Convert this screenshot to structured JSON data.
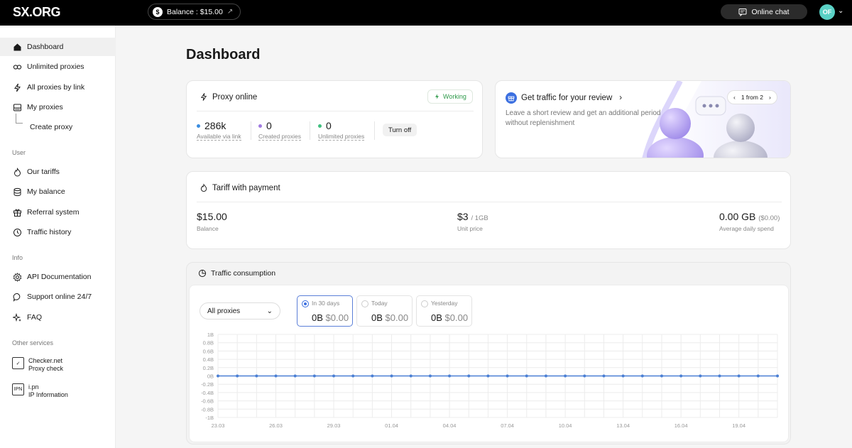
{
  "header": {
    "logo": "SX.ORG",
    "balance_label": "Balance : $15.00",
    "chat_label": "Online chat",
    "avatar_initials": "OF"
  },
  "sidebar": {
    "main_items": [
      {
        "label": "Dashboard",
        "icon": "home-icon"
      },
      {
        "label": "Unlimited proxies",
        "icon": "infinity-icon"
      },
      {
        "label": "All proxies by link",
        "icon": "bolt-icon"
      },
      {
        "label": "My proxies",
        "icon": "server-icon"
      },
      {
        "label": "Create proxy",
        "icon": ""
      }
    ],
    "user_section": "User",
    "user_items": [
      {
        "label": "Our tariffs",
        "icon": "flame-icon"
      },
      {
        "label": "My balance",
        "icon": "database-icon"
      },
      {
        "label": "Referral system",
        "icon": "gift-icon"
      },
      {
        "label": "Traffic history",
        "icon": "clock-icon"
      }
    ],
    "info_section": "Info",
    "info_items": [
      {
        "label": "API Documentation",
        "icon": "gear-icon"
      },
      {
        "label": "Support online 24/7",
        "icon": "chat-bubble-icon"
      },
      {
        "label": "FAQ",
        "icon": "sparkle-icon"
      }
    ],
    "other_section": "Other services",
    "services": [
      {
        "title": "Checker.net",
        "subtitle": "Proxy check"
      },
      {
        "title": "i.pn",
        "subtitle": "IP Information"
      }
    ]
  },
  "main": {
    "title": "Dashboard",
    "proxy_online": {
      "title": "Proxy online",
      "status": "Working",
      "stats": [
        {
          "value": "286k",
          "label": "Available via link",
          "color": "#3b8de0"
        },
        {
          "value": "0",
          "label": "Created proxies",
          "color": "#a07be0"
        },
        {
          "value": "0",
          "label": "Unlimited proxies",
          "color": "#3fbf7f"
        }
      ],
      "turn_off_label": "Turn off"
    },
    "review": {
      "title": "Get traffic for your review",
      "text": "Leave a short review and get an additional period without replenishment",
      "pager": "1 from 2"
    },
    "tariff": {
      "title": "Tariff with payment",
      "balance_value": "$15.00",
      "balance_label": "Balance",
      "unit_value": "$3",
      "unit_suffix": "/ 1GB",
      "unit_label": "Unit price",
      "spend_value": "0.00 GB",
      "spend_suffix": "($0.00)",
      "spend_label": "Average daily spend"
    },
    "traffic": {
      "title": "Traffic consumption",
      "select_value": "All proxies",
      "periods": [
        {
          "name": "In 30 days",
          "bytes": "0B",
          "money": "$0.00",
          "selected": true
        },
        {
          "name": "Today",
          "bytes": "0B",
          "money": "$0.00",
          "selected": false
        },
        {
          "name": "Yesterday",
          "bytes": "0B",
          "money": "$0.00",
          "selected": false
        }
      ]
    }
  },
  "chart_data": {
    "type": "line",
    "title": "",
    "xlabel": "",
    "ylabel": "",
    "x": [
      "23.03",
      "24.03",
      "25.03",
      "26.03",
      "27.03",
      "28.03",
      "29.03",
      "30.03",
      "31.03",
      "01.04",
      "02.04",
      "03.04",
      "04.04",
      "05.04",
      "06.04",
      "07.04",
      "08.04",
      "09.04",
      "10.04",
      "11.04",
      "12.04",
      "13.04",
      "14.04",
      "15.04",
      "16.04",
      "17.04",
      "18.04",
      "19.04",
      "20.04",
      "21.04"
    ],
    "x_tick_labels": [
      "23.03",
      "26.03",
      "29.03",
      "01.04",
      "04.04",
      "07.04",
      "10.04",
      "13.04",
      "16.04",
      "19.04"
    ],
    "y_tick_labels": [
      "1B",
      "0.8B",
      "0.6B",
      "0.4B",
      "0.2B",
      "0B",
      "-0.2B",
      "-0.4B",
      "-0.6B",
      "-0.8B",
      "-1B"
    ],
    "ylim": [
      -1,
      1
    ],
    "series": [
      {
        "values": [
          0,
          0,
          0,
          0,
          0,
          0,
          0,
          0,
          0,
          0,
          0,
          0,
          0,
          0,
          0,
          0,
          0,
          0,
          0,
          0,
          0,
          0,
          0,
          0,
          0,
          0,
          0,
          0,
          0,
          0
        ]
      }
    ],
    "grid": true,
    "line_color": "#4a7fd4"
  }
}
